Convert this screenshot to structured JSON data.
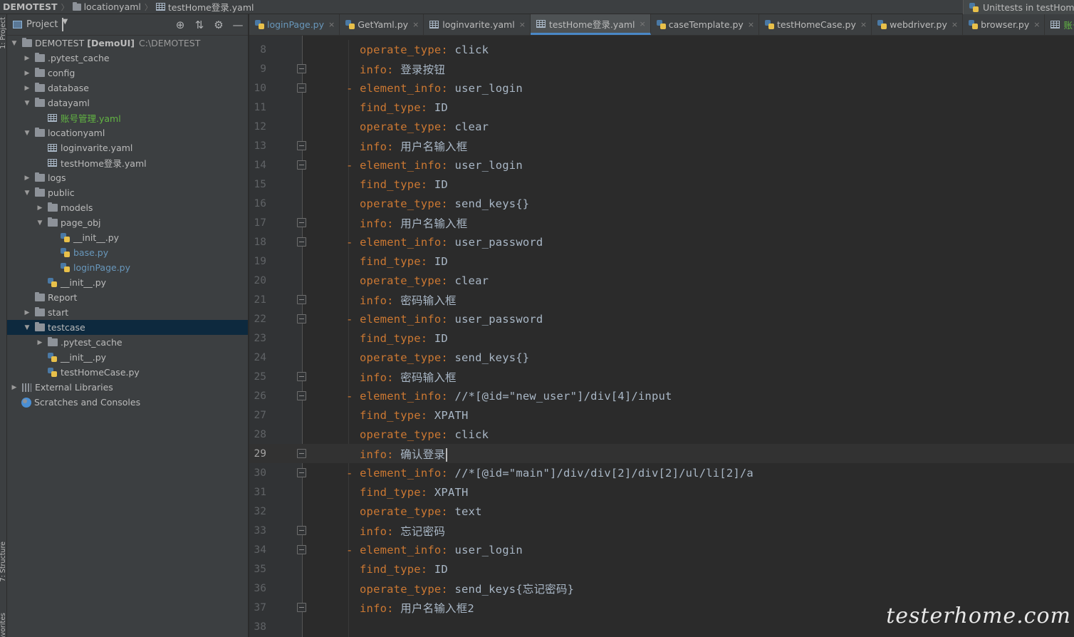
{
  "breadcrumb": {
    "items": [
      {
        "label": "DEMOTEST",
        "icon": "none"
      },
      {
        "label": "locationyaml",
        "icon": "folder-icon"
      },
      {
        "label": "testHome登录.yaml",
        "icon": "yaml-file-icon"
      }
    ]
  },
  "run_config": {
    "label": "Unittests in testHomeC"
  },
  "tool_strip": {
    "project_tab": "1: Project",
    "structure_tab": "7: Structure",
    "favorites_tab": "Favorites"
  },
  "project_panel": {
    "title": "Project",
    "tree": [
      {
        "label": "DEMOTEST",
        "extra": "[DemoUI]",
        "path": "C:\\DEMOTEST",
        "depth": 0,
        "arrow": "down",
        "icon": "folder"
      },
      {
        "label": ".pytest_cache",
        "depth": 1,
        "arrow": "right",
        "icon": "folder"
      },
      {
        "label": "config",
        "depth": 1,
        "arrow": "right",
        "icon": "folder"
      },
      {
        "label": "database",
        "depth": 1,
        "arrow": "right",
        "icon": "folder"
      },
      {
        "label": "datayaml",
        "depth": 1,
        "arrow": "down",
        "icon": "folder"
      },
      {
        "label": "账号管理.yaml",
        "depth": 2,
        "arrow": "",
        "icon": "yaml",
        "color": "green"
      },
      {
        "label": "locationyaml",
        "depth": 1,
        "arrow": "down",
        "icon": "folder"
      },
      {
        "label": "loginvarite.yaml",
        "depth": 2,
        "arrow": "",
        "icon": "yaml"
      },
      {
        "label": "testHome登录.yaml",
        "depth": 2,
        "arrow": "",
        "icon": "yaml"
      },
      {
        "label": "logs",
        "depth": 1,
        "arrow": "right",
        "icon": "folder"
      },
      {
        "label": "public",
        "depth": 1,
        "arrow": "down",
        "icon": "folder"
      },
      {
        "label": "models",
        "depth": 2,
        "arrow": "right",
        "icon": "folder"
      },
      {
        "label": "page_obj",
        "depth": 2,
        "arrow": "down",
        "icon": "folder"
      },
      {
        "label": "__init__.py",
        "depth": 3,
        "arrow": "",
        "icon": "py"
      },
      {
        "label": "base.py",
        "depth": 3,
        "arrow": "",
        "icon": "py",
        "color": "blue"
      },
      {
        "label": "loginPage.py",
        "depth": 3,
        "arrow": "",
        "icon": "py",
        "color": "blue"
      },
      {
        "label": "__init__.py",
        "depth": 2,
        "arrow": "",
        "icon": "py"
      },
      {
        "label": "Report",
        "depth": 1,
        "arrow": "",
        "icon": "folder"
      },
      {
        "label": "start",
        "depth": 1,
        "arrow": "right",
        "icon": "folder"
      },
      {
        "label": "testcase",
        "depth": 1,
        "arrow": "down",
        "icon": "folder",
        "selected": true
      },
      {
        "label": ".pytest_cache",
        "depth": 2,
        "arrow": "right",
        "icon": "folder"
      },
      {
        "label": "__init__.py",
        "depth": 2,
        "arrow": "",
        "icon": "py"
      },
      {
        "label": "testHomeCase.py",
        "depth": 2,
        "arrow": "",
        "icon": "py"
      },
      {
        "label": "External Libraries",
        "depth": 0,
        "arrow": "right",
        "icon": "lib"
      },
      {
        "label": "Scratches and Consoles",
        "depth": 0,
        "arrow": "",
        "icon": "scratch"
      }
    ]
  },
  "tabs": [
    {
      "label": "loginPage.py",
      "icon": "py",
      "color": "blue"
    },
    {
      "label": "GetYaml.py",
      "icon": "py"
    },
    {
      "label": "loginvarite.yaml",
      "icon": "yaml"
    },
    {
      "label": "testHome登录.yaml",
      "icon": "yaml",
      "active": true
    },
    {
      "label": "caseTemplate.py",
      "icon": "py"
    },
    {
      "label": "testHomeCase.py",
      "icon": "py"
    },
    {
      "label": "webdriver.py",
      "icon": "py"
    },
    {
      "label": "browser.py",
      "icon": "py"
    },
    {
      "label": "账号管理.yaml",
      "icon": "yaml",
      "color": "green"
    }
  ],
  "editor": {
    "current_line": 29,
    "lines": [
      {
        "n": "8",
        "dash": false,
        "key": "operate_type",
        "value": "click",
        "fold": false
      },
      {
        "n": "9",
        "dash": false,
        "key": "info",
        "value": "登录按钮",
        "fold": true
      },
      {
        "n": "10",
        "dash": true,
        "key": "element_info",
        "value": "user_login",
        "fold": true
      },
      {
        "n": "11",
        "dash": false,
        "key": "find_type",
        "value": "ID",
        "fold": false
      },
      {
        "n": "12",
        "dash": false,
        "key": "operate_type",
        "value": "clear",
        "fold": false
      },
      {
        "n": "13",
        "dash": false,
        "key": "info",
        "value": "用户名输入框",
        "fold": true
      },
      {
        "n": "14",
        "dash": true,
        "key": "element_info",
        "value": "user_login",
        "fold": true
      },
      {
        "n": "15",
        "dash": false,
        "key": "find_type",
        "value": "ID",
        "fold": false
      },
      {
        "n": "16",
        "dash": false,
        "key": "operate_type",
        "value": "send_keys{}",
        "fold": false
      },
      {
        "n": "17",
        "dash": false,
        "key": "info",
        "value": "用户名输入框",
        "fold": true
      },
      {
        "n": "18",
        "dash": true,
        "key": "element_info",
        "value": "user_password",
        "fold": true
      },
      {
        "n": "19",
        "dash": false,
        "key": "find_type",
        "value": "ID",
        "fold": false
      },
      {
        "n": "20",
        "dash": false,
        "key": "operate_type",
        "value": "clear",
        "fold": false
      },
      {
        "n": "21",
        "dash": false,
        "key": "info",
        "value": "密码输入框",
        "fold": true
      },
      {
        "n": "22",
        "dash": true,
        "key": "element_info",
        "value": "user_password",
        "fold": true
      },
      {
        "n": "23",
        "dash": false,
        "key": "find_type",
        "value": "ID",
        "fold": false
      },
      {
        "n": "24",
        "dash": false,
        "key": "operate_type",
        "value": "send_keys{}",
        "fold": false
      },
      {
        "n": "25",
        "dash": false,
        "key": "info",
        "value": "密码输入框",
        "fold": true
      },
      {
        "n": "26",
        "dash": true,
        "key": "element_info",
        "value": "//*[@id=\"new_user\"]/div[4]/input",
        "fold": true
      },
      {
        "n": "27",
        "dash": false,
        "key": "find_type",
        "value": "XPATH",
        "fold": false
      },
      {
        "n": "28",
        "dash": false,
        "key": "operate_type",
        "value": "click",
        "fold": false
      },
      {
        "n": "29",
        "dash": false,
        "key": "info",
        "value": "确认登录",
        "fold": true
      },
      {
        "n": "30",
        "dash": true,
        "key": "element_info",
        "value": "//*[@id=\"main\"]/div/div[2]/div[2]/ul/li[2]/a",
        "fold": true
      },
      {
        "n": "31",
        "dash": false,
        "key": "find_type",
        "value": "XPATH",
        "fold": false
      },
      {
        "n": "32",
        "dash": false,
        "key": "operate_type",
        "value": "text",
        "fold": false
      },
      {
        "n": "33",
        "dash": false,
        "key": "info",
        "value": "忘记密码",
        "fold": true
      },
      {
        "n": "34",
        "dash": true,
        "key": "element_info",
        "value": "user_login",
        "fold": true
      },
      {
        "n": "35",
        "dash": false,
        "key": "find_type",
        "value": "ID",
        "fold": false
      },
      {
        "n": "36",
        "dash": false,
        "key": "operate_type",
        "value": "send_keys{忘记密码}",
        "fold": false
      },
      {
        "n": "37",
        "dash": false,
        "key": "info",
        "value": "用户名输入框2",
        "fold": true
      },
      {
        "n": "38",
        "dash": false,
        "key": "",
        "value": "",
        "fold": false
      }
    ]
  },
  "watermark": "testerhome.com",
  "colors": {
    "keyword": "#cc7832",
    "text": "#a9b7c6",
    "accent": "#4a88c7",
    "selection": "#0d293e",
    "green": "#62b543",
    "blue": "#6897bb"
  }
}
